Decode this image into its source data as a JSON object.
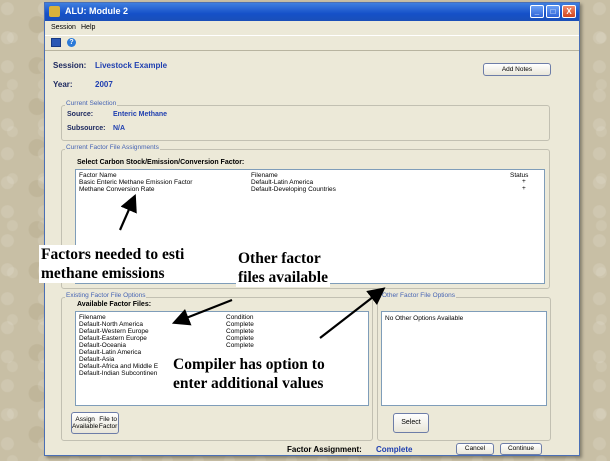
{
  "window": {
    "title": "ALU: Module 2",
    "controls": {
      "minimize": "_",
      "maximize": "□",
      "close": "X"
    }
  },
  "menu": {
    "items": [
      "Session",
      "Help"
    ]
  },
  "toolbar": {
    "icons": [
      "save-icon",
      "help-icon"
    ]
  },
  "header": {
    "session_label": "Session:",
    "session_value": "Livestock Example",
    "year_label": "Year:",
    "year_value": "2007",
    "add_notes_button": "Add Notes"
  },
  "current_selection": {
    "group_label": "Current Selection",
    "source_label": "Source:",
    "source_value": "Enteric Methane",
    "subsource_label": "Subsource:",
    "subsource_value": "N/A"
  },
  "current_assignments": {
    "group_label": "Current Factor File Assignments",
    "title": "Select Carbon Stock/Emission/Conversion Factor:",
    "columns": [
      "Factor Name",
      "Filename",
      "Status"
    ],
    "rows": [
      {
        "factor": "Basic Enteric Methane Emission Factor",
        "filename": "Default-Latin America",
        "status": "+"
      },
      {
        "factor": "Methane Conversion Rate",
        "filename": "Default-Developing Countries",
        "status": "+"
      }
    ]
  },
  "existing_options": {
    "group_label": "Existing Factor File Options",
    "title": "Available Factor Files:",
    "columns": [
      "Filename",
      "Condition"
    ],
    "rows": [
      {
        "filename": "Default-North America",
        "condition": "Complete"
      },
      {
        "filename": "Default-Western Europe",
        "condition": "Complete"
      },
      {
        "filename": "Default-Eastern Europe",
        "condition": "Complete"
      },
      {
        "filename": "Default-Oceania",
        "condition": "Complete"
      },
      {
        "filename": "Default-Latin America",
        "condition": ""
      },
      {
        "filename": "Default-Asia",
        "condition": ""
      },
      {
        "filename": "Default-Africa and Middle E",
        "condition": ""
      },
      {
        "filename": "Default-Indian Subcontinen",
        "condition": ""
      }
    ],
    "assign_button_line1": "Assign Available",
    "assign_button_line2": "File to Factor"
  },
  "other_options": {
    "group_label": "Other Factor File Options",
    "empty_text": "No Other Options Available",
    "select_button": "Select"
  },
  "footer": {
    "assignment_label": "Factor Assignment:",
    "assignment_value": "Complete",
    "cancel_button": "Cancel",
    "continue_button": "Continue"
  },
  "annotations": {
    "factors_needed_line1": "Factors needed to esti",
    "factors_needed_line2": "methane emissions",
    "other_files_line1": "Other factor",
    "other_files_line2": "files available",
    "compiler_line1": "Compiler has option to",
    "compiler_line2": "enter additional values"
  }
}
